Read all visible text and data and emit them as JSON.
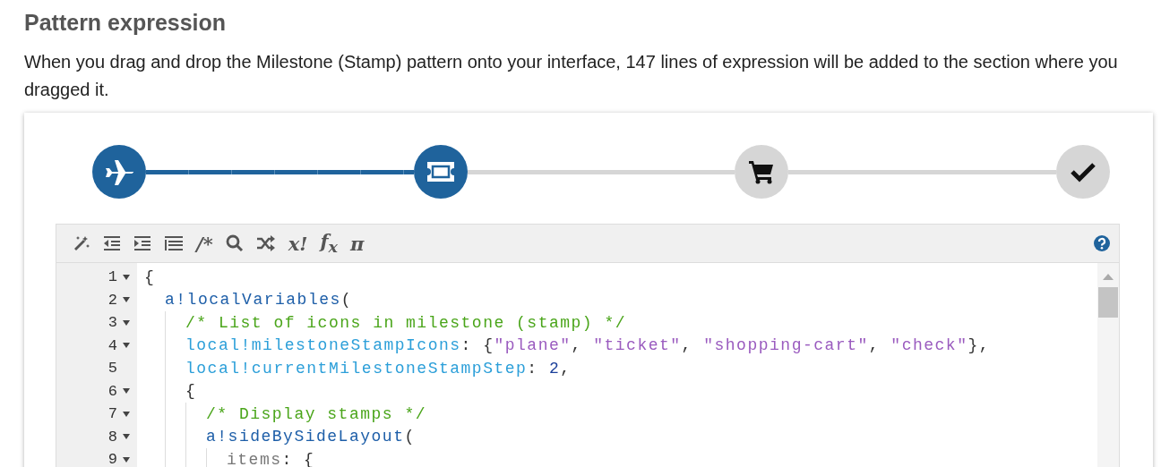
{
  "heading": "Pattern expression",
  "description": "When you drag and drop the Milestone (Stamp) pattern onto your interface, 147 lines of expression will be added to the section where you dragged it.",
  "milestones": [
    {
      "kind": "plane",
      "reached": true
    },
    {
      "kind": "ticket",
      "reached": true
    },
    {
      "kind": "cart",
      "reached": false
    },
    {
      "kind": "check",
      "reached": false
    }
  ],
  "toolbar": [
    {
      "kind": "wand"
    },
    {
      "kind": "outdent"
    },
    {
      "kind": "indent"
    },
    {
      "kind": "format"
    },
    {
      "kind": "text",
      "label": "/*"
    },
    {
      "kind": "search"
    },
    {
      "kind": "shuffle"
    },
    {
      "kind": "text",
      "label": "x!"
    },
    {
      "kind": "text",
      "label": "f$_{x}$"
    },
    {
      "kind": "text",
      "label": "π"
    }
  ],
  "code": [
    {
      "number": "1",
      "foldable": true,
      "tokens": [
        {
          "kind": "punct",
          "text": "{"
        }
      ],
      "children": [
        {
          "number": "2",
          "foldable": true,
          "tokens": [
            {
              "kind": "func",
              "text": "a!localVariables"
            },
            {
              "kind": "punct",
              "text": "("
            }
          ],
          "children": [
            {
              "number": "3",
              "foldable": true,
              "tokens": [
                {
                  "kind": "comment",
                  "text": "/* List of icons in milestone (stamp) */"
                }
              ]
            },
            {
              "number": "4",
              "foldable": true,
              "tokens": [
                {
                  "kind": "var",
                  "text": "local!milestoneStampIcons"
                },
                {
                  "kind": "punct",
                  "text": ": {"
                },
                {
                  "kind": "string",
                  "text": "\"plane\""
                },
                {
                  "kind": "punct",
                  "text": ", "
                },
                {
                  "kind": "string",
                  "text": "\"ticket\""
                },
                {
                  "kind": "punct",
                  "text": ", "
                },
                {
                  "kind": "string",
                  "text": "\"shopping-cart\""
                },
                {
                  "kind": "punct",
                  "text": ", "
                },
                {
                  "kind": "string",
                  "text": "\"check\""
                },
                {
                  "kind": "punct",
                  "text": "},"
                }
              ]
            },
            {
              "number": "5",
              "foldable": false,
              "tokens": [
                {
                  "kind": "var",
                  "text": "local!currentMilestoneStampStep"
                },
                {
                  "kind": "punct",
                  "text": ": "
                },
                {
                  "kind": "number",
                  "text": "2"
                },
                {
                  "kind": "punct",
                  "text": ","
                }
              ]
            },
            {
              "number": "6",
              "foldable": true,
              "tokens": [
                {
                  "kind": "punct",
                  "text": "{"
                }
              ],
              "children": [
                {
                  "number": "7",
                  "foldable": true,
                  "tokens": [
                    {
                      "kind": "comment",
                      "text": "/* Display stamps */"
                    }
                  ]
                },
                {
                  "number": "8",
                  "foldable": true,
                  "tokens": [
                    {
                      "kind": "func",
                      "text": "a!sideBySideLayout"
                    },
                    {
                      "kind": "punct",
                      "text": "("
                    }
                  ],
                  "children": [
                    {
                      "number": "9",
                      "foldable": true,
                      "tokens": [
                        {
                          "kind": "key",
                          "text": "items"
                        },
                        {
                          "kind": "punct",
                          "text": ": {"
                        }
                      ]
                    }
                  ]
                }
              ]
            }
          ]
        }
      ]
    }
  ]
}
